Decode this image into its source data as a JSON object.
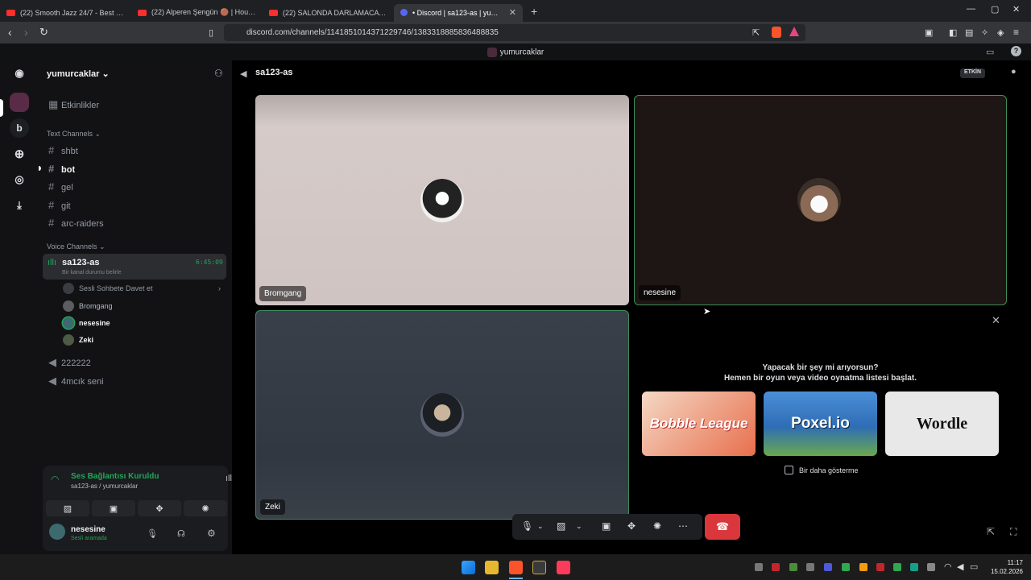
{
  "browser": {
    "tabs": [
      {
        "label": "(22) Smooth Jazz 24/7 - Best Smooth"
      },
      {
        "label": "(22) Alperen Şengün 🟤 | Houston R"
      },
      {
        "label": "(22) SALONDA DARLAMACA - YouTu"
      },
      {
        "label": "• Discord | sa123-as | yumurc"
      }
    ],
    "url": "discord.com/channels/1141851014371229746/1383318885836488835"
  },
  "discord": {
    "top_title": "yumurcaklar",
    "guild_name": "yumurcaklar",
    "guild_letter": "b",
    "events_label": "Etkinlikler",
    "text_category": "Text Channels",
    "text_channels": [
      "shbt",
      "bot",
      "gel",
      "git",
      "arc-raiders"
    ],
    "voice_category": "Voice Channels",
    "active_voice": {
      "name": "sa123-as",
      "timer": "6:45:09",
      "status_hint": "Bir kanal durumu belirle",
      "invite_label": "Sesli Sohbete Davet et",
      "members": [
        "Bromgang",
        "nesesine",
        "Zeki"
      ]
    },
    "other_voice": [
      "222222",
      "4mcık seni"
    ],
    "voice_panel": {
      "status": "Ses Bağlantısı Kuruldu",
      "sub": "sa123-as / yumurcaklar"
    },
    "user": {
      "name": "nesesine",
      "status": "Sesli aramada"
    },
    "stage": {
      "channel_title": "sa123-as",
      "badge": "ETKİN",
      "tiles": [
        {
          "name": "Bromgang"
        },
        {
          "name": "nesesine"
        },
        {
          "name": "Zeki"
        }
      ],
      "activity_prompt_1": "Yapacak bir şey mi arıyorsun?",
      "activity_prompt_2": "Hemen bir oyun veya video oynatma listesi başlat.",
      "games": [
        "Bobble League",
        "Poxel.io",
        "Wordle"
      ],
      "dont_show": "Bir daha gösterme"
    }
  },
  "taskbar": {
    "time": "11:17",
    "date": "15.02.2026"
  },
  "colors": {
    "accent_green": "#23a55a",
    "hangup_red": "#da373c"
  }
}
